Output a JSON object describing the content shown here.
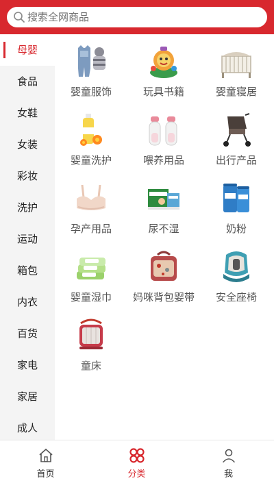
{
  "search": {
    "placeholder": "搜索全网商品"
  },
  "sidebar": {
    "items": [
      {
        "label": "母婴",
        "active": true
      },
      {
        "label": "食品"
      },
      {
        "label": "女鞋"
      },
      {
        "label": "女装"
      },
      {
        "label": "彩妆"
      },
      {
        "label": "洗护"
      },
      {
        "label": "运动"
      },
      {
        "label": "箱包"
      },
      {
        "label": "内衣"
      },
      {
        "label": "百货"
      },
      {
        "label": "家电"
      },
      {
        "label": "家居"
      },
      {
        "label": "成人"
      }
    ]
  },
  "categories": [
    {
      "label": "婴童服饰",
      "icon": "baby-clothes-icon"
    },
    {
      "label": "玩具书籍",
      "icon": "toy-icon"
    },
    {
      "label": "婴童寝居",
      "icon": "crib-icon"
    },
    {
      "label": "婴童洗护",
      "icon": "bath-product-icon"
    },
    {
      "label": "喂养用品",
      "icon": "baby-bottle-icon"
    },
    {
      "label": "出行产品",
      "icon": "stroller-icon"
    },
    {
      "label": "孕产用品",
      "icon": "maternity-bra-icon"
    },
    {
      "label": "尿不湿",
      "icon": "diaper-icon"
    },
    {
      "label": "奶粉",
      "icon": "milk-powder-icon"
    },
    {
      "label": "婴童湿巾",
      "icon": "wet-wipes-icon"
    },
    {
      "label": "妈咪背包婴带",
      "icon": "diaper-bag-icon"
    },
    {
      "label": "安全座椅",
      "icon": "car-seat-icon"
    },
    {
      "label": "童床",
      "icon": "playpen-icon"
    }
  ],
  "tabbar": {
    "items": [
      {
        "label": "首页",
        "icon": "home-icon"
      },
      {
        "label": "分类",
        "icon": "category-icon",
        "active": true
      },
      {
        "label": "我",
        "icon": "user-icon"
      }
    ]
  },
  "colors": {
    "brand": "#d8282e",
    "sidebar_bg": "#f4f4f4"
  }
}
